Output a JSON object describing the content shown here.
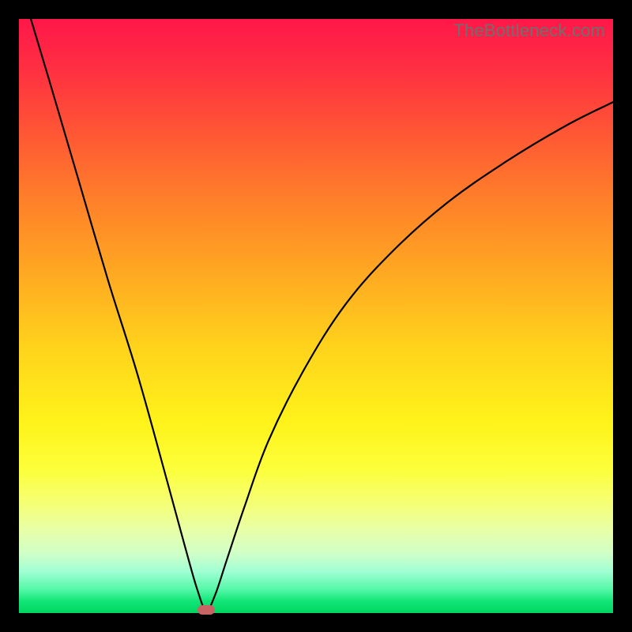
{
  "watermark": "TheBottleneck.com",
  "chart_data": {
    "type": "line",
    "title": "",
    "xlabel": "",
    "ylabel": "",
    "xlim": [
      0,
      100
    ],
    "ylim": [
      0,
      100
    ],
    "grid": false,
    "series": [
      {
        "name": "curve",
        "x": [
          2,
          5,
          10,
          15,
          20,
          25,
          28,
          30,
          31.5,
          33,
          35,
          38,
          42,
          48,
          55,
          63,
          72,
          82,
          92,
          100
        ],
        "y": [
          100,
          90,
          73,
          56,
          40,
          22,
          11,
          4,
          0.5,
          3,
          9,
          18,
          29,
          41,
          52,
          61,
          69,
          76,
          82,
          86
        ]
      }
    ],
    "marker": {
      "x": 31.5,
      "y": 0.5
    },
    "background_gradient": {
      "top": "#ff1749",
      "bottom": "#02d661"
    }
  }
}
